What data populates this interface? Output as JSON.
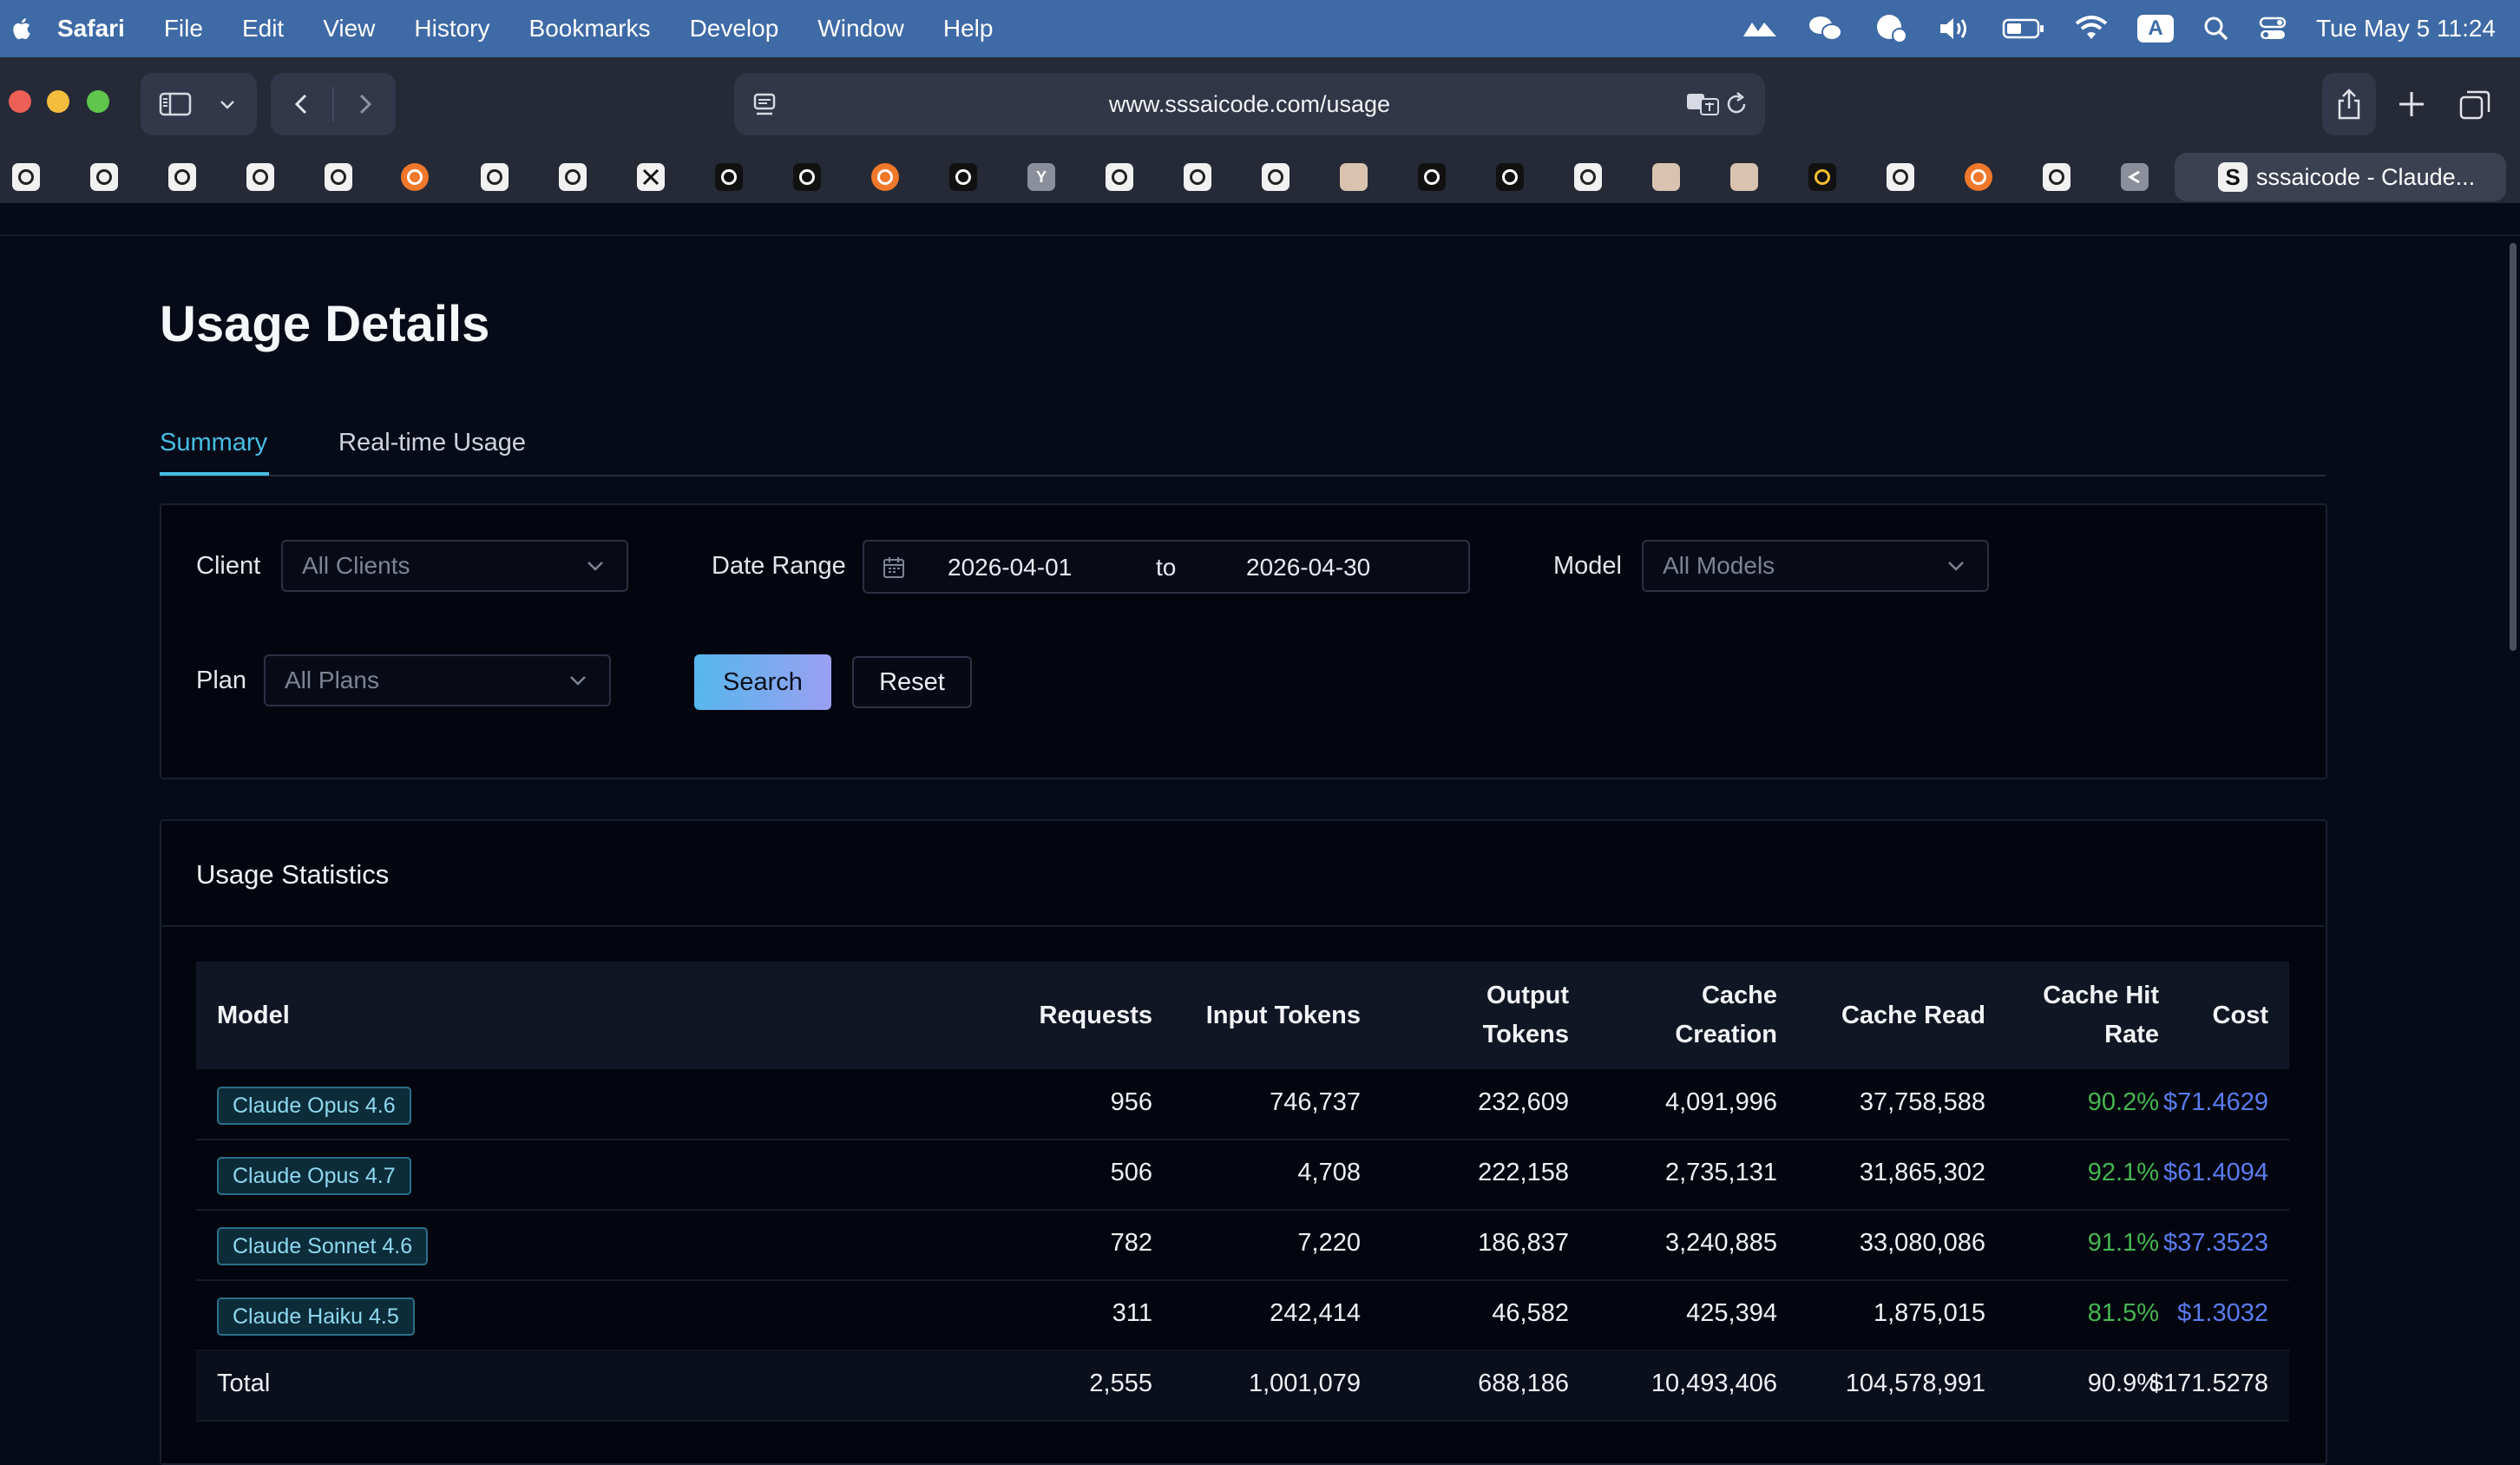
{
  "menubar": {
    "app": "Safari",
    "items": [
      "File",
      "Edit",
      "View",
      "History",
      "Bookmarks",
      "Develop",
      "Window",
      "Help"
    ],
    "input_source": "A",
    "clock": "Tue May 5  11:24"
  },
  "browser": {
    "url": "www.sssaicode.com/usage",
    "active_tab_title": "sssaicode - Claude...",
    "active_tab_favicon": "S",
    "bookmark_y_label": "Y"
  },
  "page": {
    "title": "Usage Details",
    "tabs": [
      {
        "label": "Summary",
        "active": true
      },
      {
        "label": "Real-time Usage",
        "active": false
      }
    ]
  },
  "filters": {
    "client_label": "Client",
    "client_value": "All Clients",
    "date_range_label": "Date Range",
    "date_start": "2026-04-01",
    "date_separator": "to",
    "date_end": "2026-04-30",
    "model_label": "Model",
    "model_value": "All Models",
    "plan_label": "Plan",
    "plan_value": "All Plans",
    "search_label": "Search",
    "reset_label": "Reset"
  },
  "stats": {
    "title": "Usage Statistics",
    "columns": {
      "model": "Model",
      "requests": "Requests",
      "input_tokens": "Input Tokens",
      "output_tokens_1": "Output",
      "output_tokens_2": "Tokens",
      "cache_creation_1": "Cache",
      "cache_creation_2": "Creation",
      "cache_read": "Cache Read",
      "cache_hit_1": "Cache Hit",
      "cache_hit_2": "Rate",
      "cost": "Cost"
    },
    "rows": [
      {
        "model": "Claude Opus 4.6",
        "requests": "956",
        "input": "746,737",
        "output": "232,609",
        "creation": "4,091,996",
        "read": "37,758,588",
        "hit": "90.2%",
        "cost": "$71.4629"
      },
      {
        "model": "Claude Opus 4.7",
        "requests": "506",
        "input": "4,708",
        "output": "222,158",
        "creation": "2,735,131",
        "read": "31,865,302",
        "hit": "92.1%",
        "cost": "$61.4094"
      },
      {
        "model": "Claude Sonnet 4.6",
        "requests": "782",
        "input": "7,220",
        "output": "186,837",
        "creation": "3,240,885",
        "read": "33,080,086",
        "hit": "91.1%",
        "cost": "$37.3523"
      },
      {
        "model": "Claude Haiku 4.5",
        "requests": "311",
        "input": "242,414",
        "output": "46,582",
        "creation": "425,394",
        "read": "1,875,015",
        "hit": "81.5%",
        "cost": "$1.3032"
      }
    ],
    "total": {
      "label": "Total",
      "requests": "2,555",
      "input": "1,001,079",
      "output": "688,186",
      "creation": "10,493,406",
      "read": "104,578,991",
      "hit": "90.9%",
      "cost": "$171.5278"
    }
  },
  "colors": {
    "accent": "#46bde4",
    "hit_rate": "#45b652",
    "cost": "#5a7cf0",
    "menubar": "#3e6aa6"
  }
}
